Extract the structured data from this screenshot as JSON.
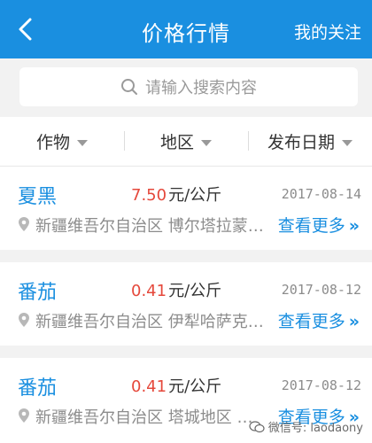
{
  "header": {
    "back_icon": "chevron-left-icon",
    "title": "价格行情",
    "follow_label": "我的关注"
  },
  "search": {
    "icon": "search-icon",
    "placeholder": "请输入搜索内容"
  },
  "filters": [
    {
      "label": "作物"
    },
    {
      "label": "地区"
    },
    {
      "label": "发布日期"
    }
  ],
  "listings": [
    {
      "crop": "夏黑",
      "price": "7.50",
      "unit": "元/公斤",
      "date": "2017-08-14",
      "location": "新疆维吾尔自治区 博尔塔拉蒙…",
      "more_label": "查看更多"
    },
    {
      "crop": "番茄",
      "price": "0.41",
      "unit": "元/公斤",
      "date": "2017-08-12",
      "location": "新疆维吾尔自治区 伊犁哈萨克…",
      "more_label": "查看更多"
    },
    {
      "crop": "番茄",
      "price": "0.41",
      "unit": "元/公斤",
      "date": "2017-08-12",
      "location": "新疆维吾尔自治区 塔城地区 乌苏",
      "more_label": "查看更多"
    }
  ],
  "watermark": {
    "text": "微信号: laodaony"
  },
  "colors": {
    "primary": "#1a8fe0",
    "price": "#e5483b",
    "background": "#f2f2f2"
  }
}
